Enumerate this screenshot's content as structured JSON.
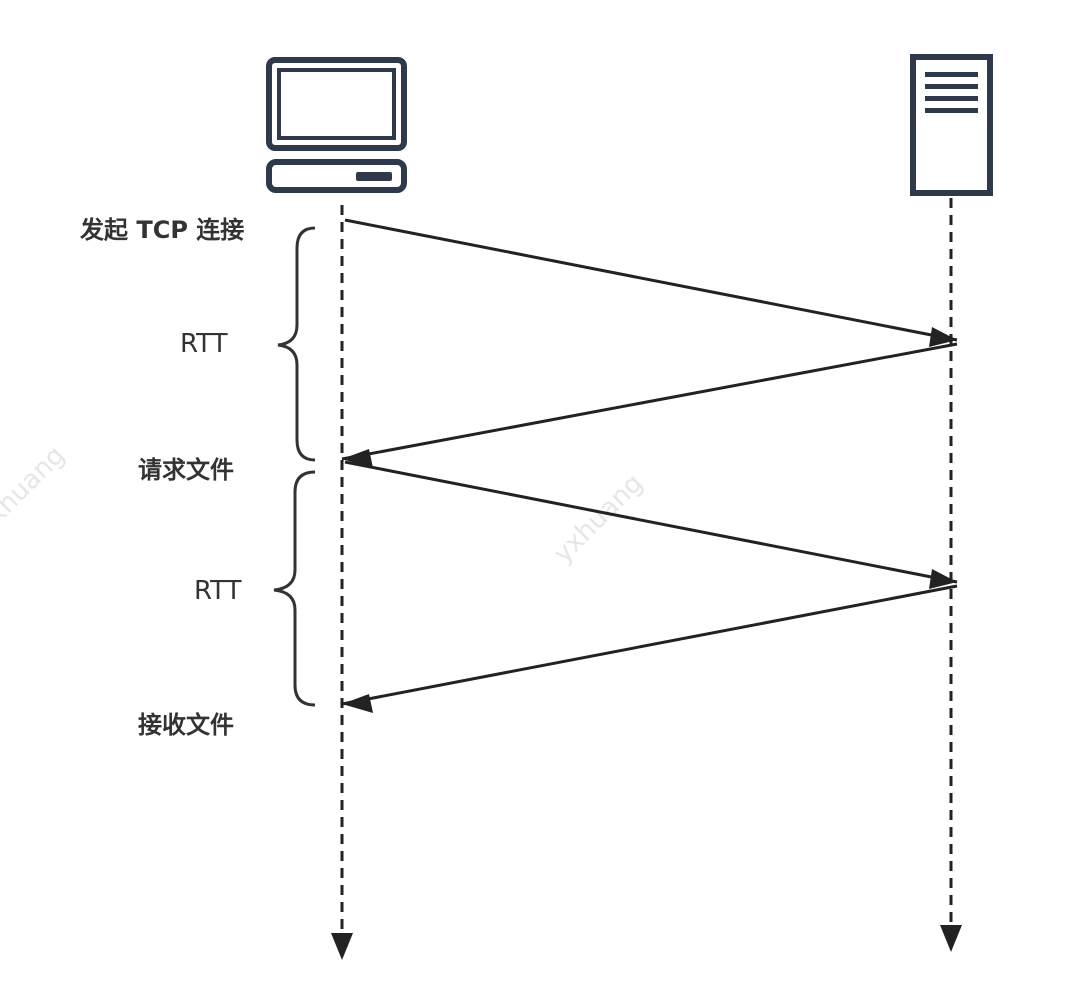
{
  "diagram": {
    "type": "sequence-diagram",
    "participants": [
      {
        "id": "client",
        "icon": "desktop-computer-icon"
      },
      {
        "id": "server",
        "icon": "server-tower-icon"
      }
    ],
    "events": [
      {
        "id": "connect",
        "label": "发起 TCP 连接"
      },
      {
        "id": "request",
        "label": "请求文件"
      },
      {
        "id": "receive",
        "label": "接收文件"
      }
    ],
    "intervals": [
      {
        "label": "RTT"
      },
      {
        "label": "RTT"
      }
    ],
    "messages": [
      {
        "from": "client",
        "to": "server"
      },
      {
        "from": "server",
        "to": "client"
      },
      {
        "from": "client",
        "to": "server"
      },
      {
        "from": "server",
        "to": "client"
      }
    ],
    "watermark": "yxhuang",
    "colors": {
      "stroke": "#222222",
      "icon": "#2e3a4b",
      "text": "#333333",
      "watermark": "#e6e6e6"
    }
  }
}
